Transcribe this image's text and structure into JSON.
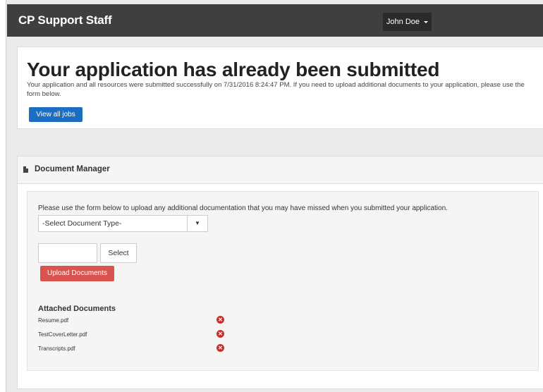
{
  "navbar": {
    "brand": "CP Support Staff",
    "user": "John Doe"
  },
  "status": {
    "title": "Your application has already been submitted",
    "message": "Your application and all resources were submitted successfully on 7/31/2016 8:24:47 PM. If you need to upload additional documents to your application, please use the form below.",
    "view_jobs": "View all jobs"
  },
  "doc_manager": {
    "title": "Document Manager",
    "instructions": "Please use the form below to upload any additional documentation that you may have missed when you submitted your application.",
    "select_placeholder": "-Select Document Type-",
    "select_button": "Select",
    "upload_button": "Upload Documents",
    "attached_title": "Attached Documents",
    "files": [
      {
        "name": "Resume.pdf"
      },
      {
        "name": "TestCoverLetter.pdf"
      },
      {
        "name": "Transcripts.pdf"
      }
    ]
  },
  "colors": {
    "navbar": "#3f3f3f",
    "primary": "#1c6ec2",
    "danger": "#d9534f"
  },
  "icons": {
    "doc": "document-icon",
    "remove": "remove-icon",
    "caret": "caret-down-icon"
  }
}
